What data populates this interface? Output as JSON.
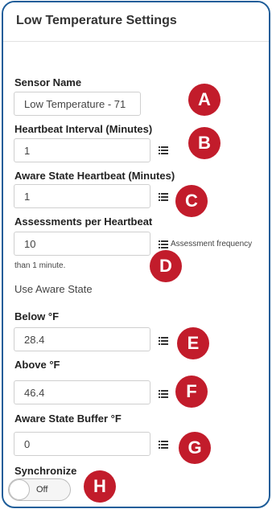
{
  "header": {
    "title": "Low Temperature Settings"
  },
  "fields": {
    "sensor_name": {
      "label": "Sensor Name",
      "value": "Low Temperature - 71"
    },
    "heartbeat": {
      "label": "Heartbeat Interval (Minutes)",
      "value": "1"
    },
    "aware_heartbeat": {
      "label": "Aware State Heartbeat (Minutes)",
      "value": "1"
    },
    "assessments": {
      "label": "Assessments per Heartbeat",
      "value": "10",
      "hint": "Assessment frequency",
      "hint_cont": "than 1 minute."
    },
    "use_aware_state": {
      "label": "Use Aware State"
    },
    "below": {
      "label": "Below °F",
      "value": "28.4"
    },
    "above": {
      "label": "Above °F",
      "value": "46.4"
    },
    "aware_buffer": {
      "label": "Aware State Buffer °F",
      "value": "0"
    },
    "synchronize": {
      "label": "Synchronize",
      "state": "Off"
    }
  },
  "badges": [
    "A",
    "B",
    "C",
    "D",
    "E",
    "F",
    "G",
    "H"
  ],
  "colors": {
    "border": "#1e5d99",
    "badge": "#c21c2b"
  },
  "icons": {
    "options": "list-icon"
  }
}
